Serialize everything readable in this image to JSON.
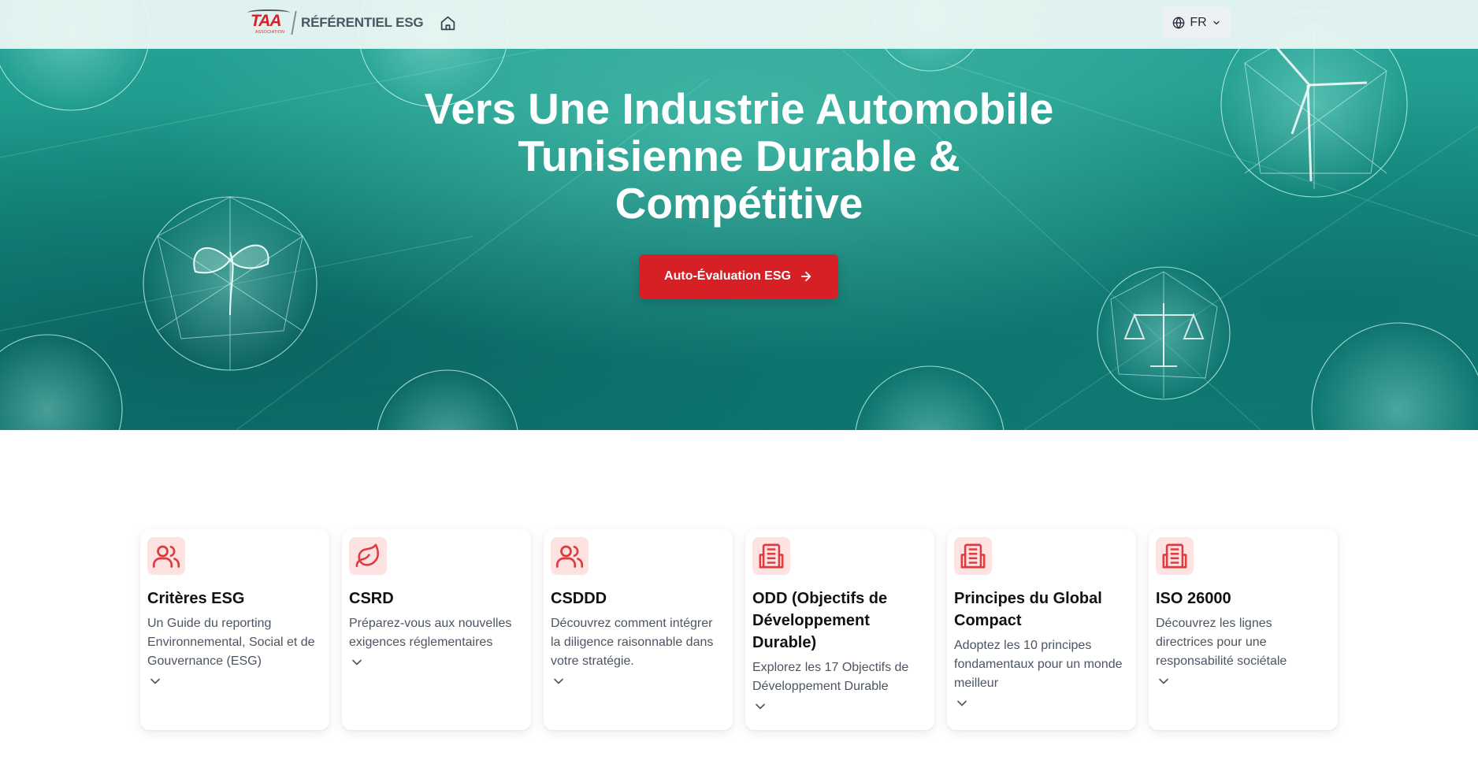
{
  "nav": {
    "logo_mark": "TAA",
    "logo_assoc": "ASSOCIATION",
    "logo_text": "RÉFÉRENTIEL ESG",
    "home_icon": "home-icon",
    "language": "FR"
  },
  "hero": {
    "title": "Vers Une Industrie Automobile Tunisienne Durable & Compétitive",
    "cta_label": "Auto-Évaluation ESG"
  },
  "colors": {
    "brand_red": "#d71f26",
    "icon_bg": "#fde2e2",
    "hero_teal": "#179384"
  },
  "cards": [
    {
      "title": "Critères ESG",
      "description": "Un Guide du reporting Environnemental, Social et de Gouvernance (ESG)",
      "icon": "users-icon"
    },
    {
      "title": "CSRD",
      "description": "Préparez-vous aux nouvelles exigences réglementaires",
      "icon": "leaf-icon"
    },
    {
      "title": "CSDDD",
      "description": "Découvrez comment intégrer la diligence raisonnable dans votre stratégie.",
      "icon": "users-icon"
    },
    {
      "title": "ODD (Objectifs de Développement Durable)",
      "description": "Explorez les 17 Objectifs de Développement Durable",
      "icon": "building-icon"
    },
    {
      "title": "Principes du Global Compact",
      "description": "Adoptez les 10 principes fondamentaux pour un monde meilleur",
      "icon": "building-icon"
    },
    {
      "title": "ISO 26000",
      "description": "Découvrez les lignes directrices pour une responsabilité sociétale",
      "icon": "building-icon"
    }
  ]
}
